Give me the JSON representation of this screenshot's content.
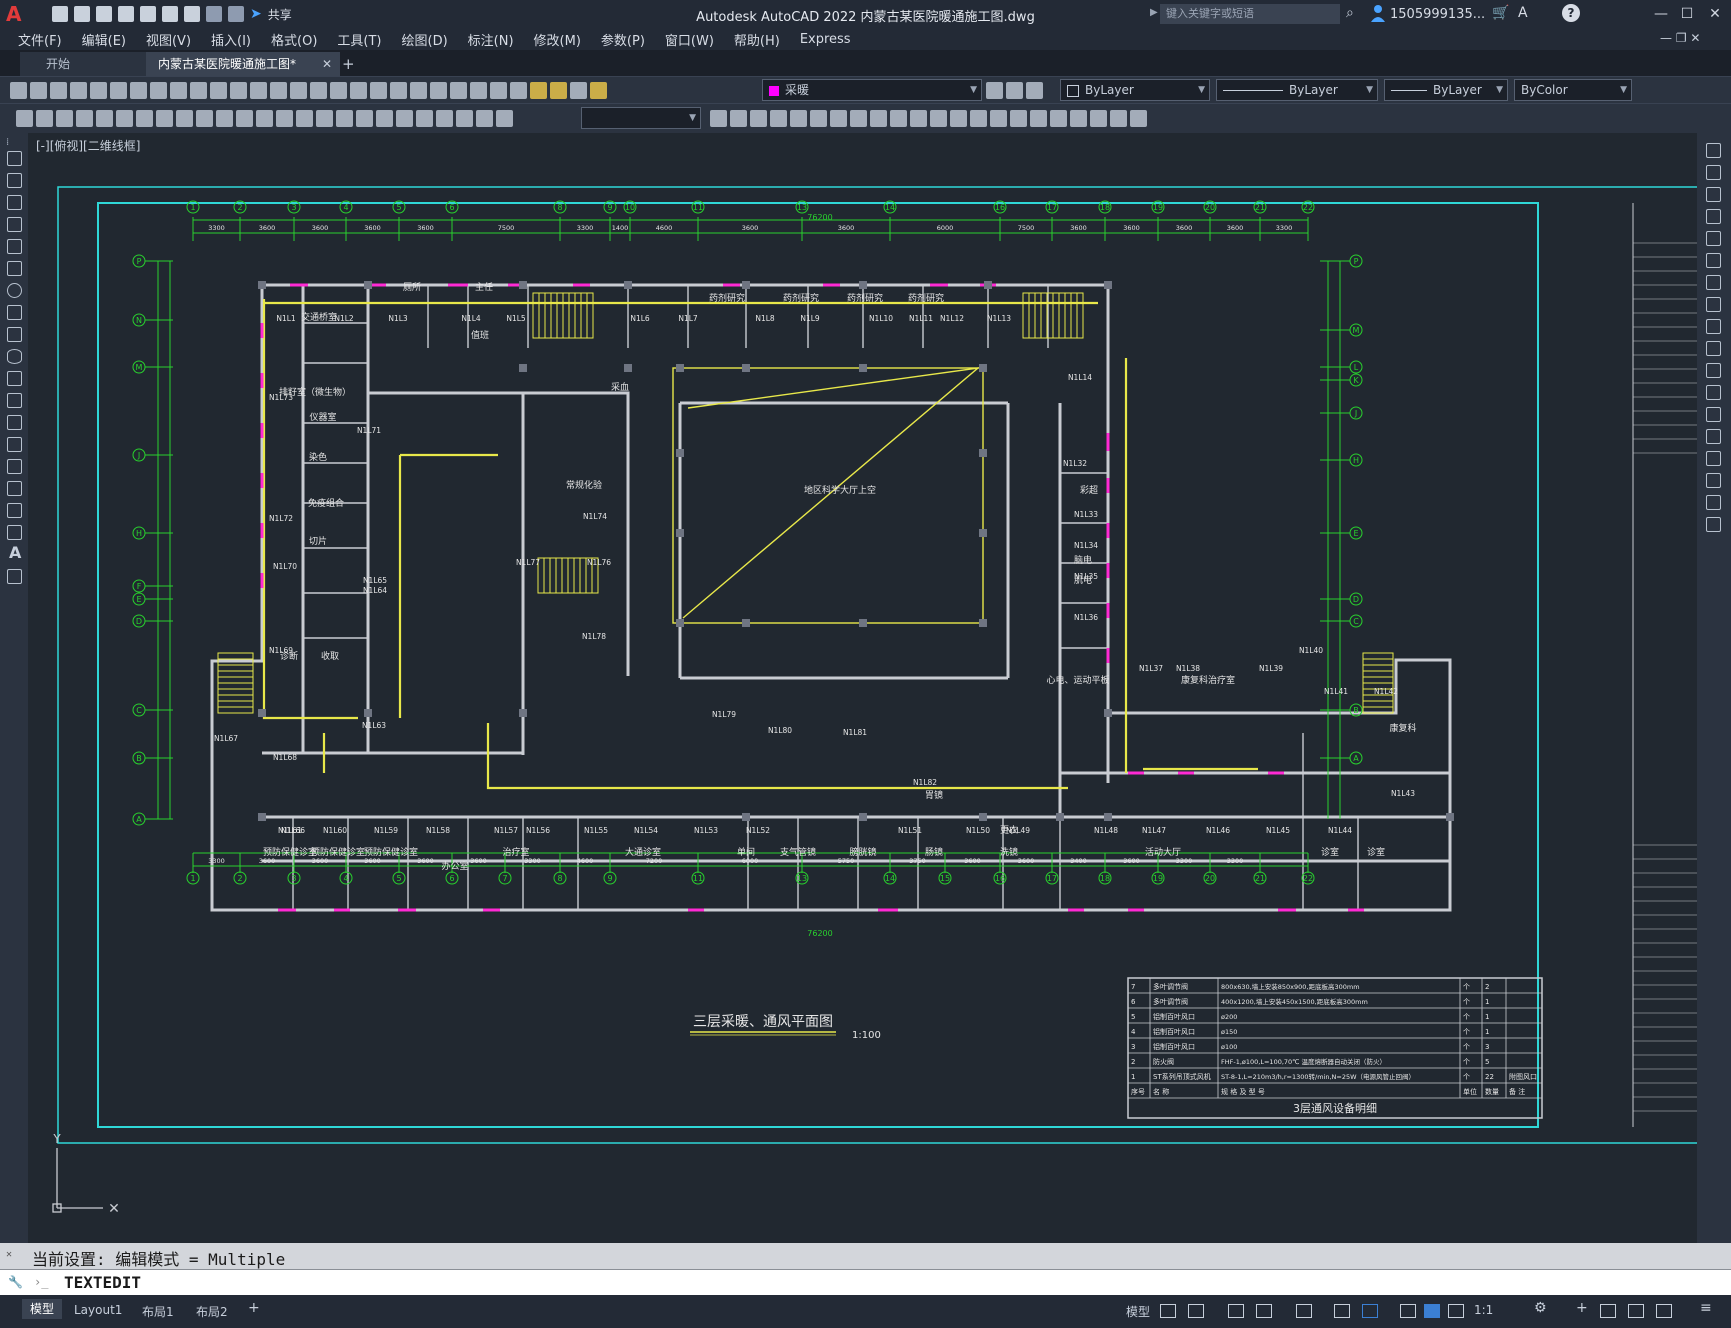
{
  "app": {
    "title": "Autodesk AutoCAD 2022    内蒙古某医院暖通施工图.dwg",
    "share_label": "共享",
    "search_placeholder": "键入关键字或短语",
    "user": "1505999135...",
    "logo": "A"
  },
  "menu": [
    "文件(F)",
    "编辑(E)",
    "视图(V)",
    "插入(I)",
    "格式(O)",
    "工具(T)",
    "绘图(D)",
    "标注(N)",
    "修改(M)",
    "参数(P)",
    "窗口(W)",
    "帮助(H)",
    "Express"
  ],
  "tabs": [
    {
      "label": "开始"
    },
    {
      "label": "内蒙古某医院暖通施工图*",
      "active": true
    }
  ],
  "properties": {
    "layer": "采暖",
    "color": "ByLayer",
    "linetype": "ByLayer",
    "lineweight": "ByLayer",
    "plotstyle": "ByColor"
  },
  "viewport_label": "[-][俯视][二维线框]",
  "drawing": {
    "plan_title": "三层采暖、通风平面图",
    "scale": "1:100",
    "total_dimension": "76200",
    "grid_top": [
      "1",
      "2",
      "3",
      "4",
      "5",
      "6",
      "8",
      "9",
      "10",
      "11",
      "13",
      "14",
      "16",
      "17",
      "18",
      "19",
      "20",
      "21",
      "22"
    ],
    "grid_bottom": [
      "1",
      "2",
      "3",
      "4",
      "5",
      "6",
      "7",
      "8",
      "9",
      "11",
      "13",
      "14",
      "15",
      "16",
      "17",
      "18",
      "19",
      "20",
      "21",
      "22"
    ],
    "grid_left": [
      "P",
      "N",
      "M",
      "J",
      "H",
      "F",
      "E",
      "D",
      "C",
      "B",
      "A"
    ],
    "grid_right": [
      "P",
      "M",
      "L",
      "K",
      "J",
      "H",
      "E",
      "D",
      "C",
      "B",
      "A"
    ],
    "dims_top": [
      "3300",
      "3600",
      "3600",
      "3600",
      "3600",
      "7500",
      "3300",
      "1400",
      "4600",
      "3600",
      "3600",
      "6000",
      "7500",
      "3600",
      "3600",
      "3600",
      "3600",
      "3300",
      "3300"
    ],
    "dims_bottom": [
      "3300",
      "3600",
      "3600",
      "3600",
      "3600",
      "3600",
      "3300",
      "4600",
      "7200",
      "6000",
      "5750",
      "3750",
      "3600",
      "3600",
      "3400",
      "3600",
      "3300",
      "3300"
    ],
    "rooms": [
      {
        "t": "交通桥室"
      },
      {
        "t": "排籽室（微生物）"
      },
      {
        "t": "仪器室"
      },
      {
        "t": "染色"
      },
      {
        "t": "免疫组合"
      },
      {
        "t": "切片"
      },
      {
        "t": "诊断"
      },
      {
        "t": "收取"
      },
      {
        "t": "厕所"
      },
      {
        "t": "主任"
      },
      {
        "t": "值班"
      },
      {
        "t": "采血"
      },
      {
        "t": "常规化验"
      },
      {
        "t": "药剂研究"
      },
      {
        "t": "药剂研究"
      },
      {
        "t": "药剂研究"
      },
      {
        "t": "药剂研究"
      },
      {
        "t": "地区科学大厅上空"
      },
      {
        "t": "彩超"
      },
      {
        "t": "脑电"
      },
      {
        "t": "肌电"
      },
      {
        "t": "心电、运动平板"
      },
      {
        "t": "康复科治疗室"
      },
      {
        "t": "康复科"
      },
      {
        "t": "预防保健诊室"
      },
      {
        "t": "预防保健诊室"
      },
      {
        "t": "预防保健诊室"
      },
      {
        "t": "办公室"
      },
      {
        "t": "治疗室"
      },
      {
        "t": "大通诊室"
      },
      {
        "t": "单间"
      },
      {
        "t": "支气管镜"
      },
      {
        "t": "膀胱镜"
      },
      {
        "t": "胃镜"
      },
      {
        "t": "肠镜"
      },
      {
        "t": "更衣"
      },
      {
        "t": "洗镜"
      },
      {
        "t": "活动大厅"
      },
      {
        "t": "诊室"
      },
      {
        "t": "诊室"
      }
    ],
    "device_tags": [
      "N1L1",
      "N1L2",
      "N1L3",
      "N1L4",
      "N1L5",
      "N1L6",
      "N1L7",
      "N1L8",
      "N1L9",
      "N1L10",
      "N1L11",
      "N1L12",
      "N1L13",
      "N1L14",
      "N1L32",
      "N1L33",
      "N1L34",
      "N1L35",
      "N1L36",
      "N1L37",
      "N1L38",
      "N1L39",
      "N1L40",
      "N1L41",
      "N1L42",
      "N1L43",
      "N1L44",
      "N1L45",
      "N1L46",
      "N1L47",
      "N1L48",
      "N1L49",
      "N1L50",
      "N1L51",
      "N1L52",
      "N1L53",
      "N1L54",
      "N1L55",
      "N1L56",
      "N1L57",
      "N1L58",
      "N1L59",
      "N1L60",
      "N1L61",
      "N1L63",
      "N1L64",
      "N1L65",
      "N1L66",
      "N1L67",
      "N1L68",
      "N1L69",
      "N1L70",
      "N1L71",
      "N1L72",
      "N1L73",
      "N1L74",
      "N1L76",
      "N1L77",
      "N1L78",
      "N1L79",
      "N1L80",
      "N1L81",
      "N1L82",
      "N1L83"
    ]
  },
  "equipment_table": {
    "title": "3层通风设备明细",
    "header": [
      "序号",
      "名  称",
      "规 格 及 型 号",
      "单位",
      "数量",
      "备 注"
    ],
    "rows": [
      [
        "7",
        "多叶调节阀",
        "800x630,墙上安装850x900,距底板高300mm",
        "个",
        "2",
        ""
      ],
      [
        "6",
        "多叶调节阀",
        "400x1200,墙上安装450x1500,距底板高300mm",
        "个",
        "1",
        ""
      ],
      [
        "5",
        "铝制百叶风口",
        "ø200",
        "个",
        "1",
        ""
      ],
      [
        "4",
        "铝制百叶风口",
        "ø150",
        "个",
        "1",
        ""
      ],
      [
        "3",
        "铝制百叶风口",
        "ø100",
        "个",
        "3",
        ""
      ],
      [
        "2",
        "防火阀",
        "FHF-1,ø100,L=100,70℃ 温度熔断器自动关闭（防火）",
        "个",
        "5",
        ""
      ],
      [
        "1",
        "ST系列吊顶式风机",
        "ST-8-1,L=210m3/h,r=1300转/min,N=25W（电源风管止回阀）",
        "个",
        "22",
        "附图风口"
      ]
    ]
  },
  "command": {
    "history": "当前设置: 编辑模式 = Multiple",
    "current": "TEXTEDIT"
  },
  "status": {
    "layouts": [
      "模型",
      "Layout1",
      "布局1",
      "布局2"
    ],
    "model_label": "模型",
    "scale": "1:1"
  },
  "colors": {
    "wall": "#c9ccd2",
    "pipe_yellow": "#e8e84a",
    "pipe_magenta": "#ff2ad4",
    "grid_green": "#29d12e",
    "frame_cyan": "#2fd7d7",
    "accent_blue": "#3b7fd4"
  }
}
